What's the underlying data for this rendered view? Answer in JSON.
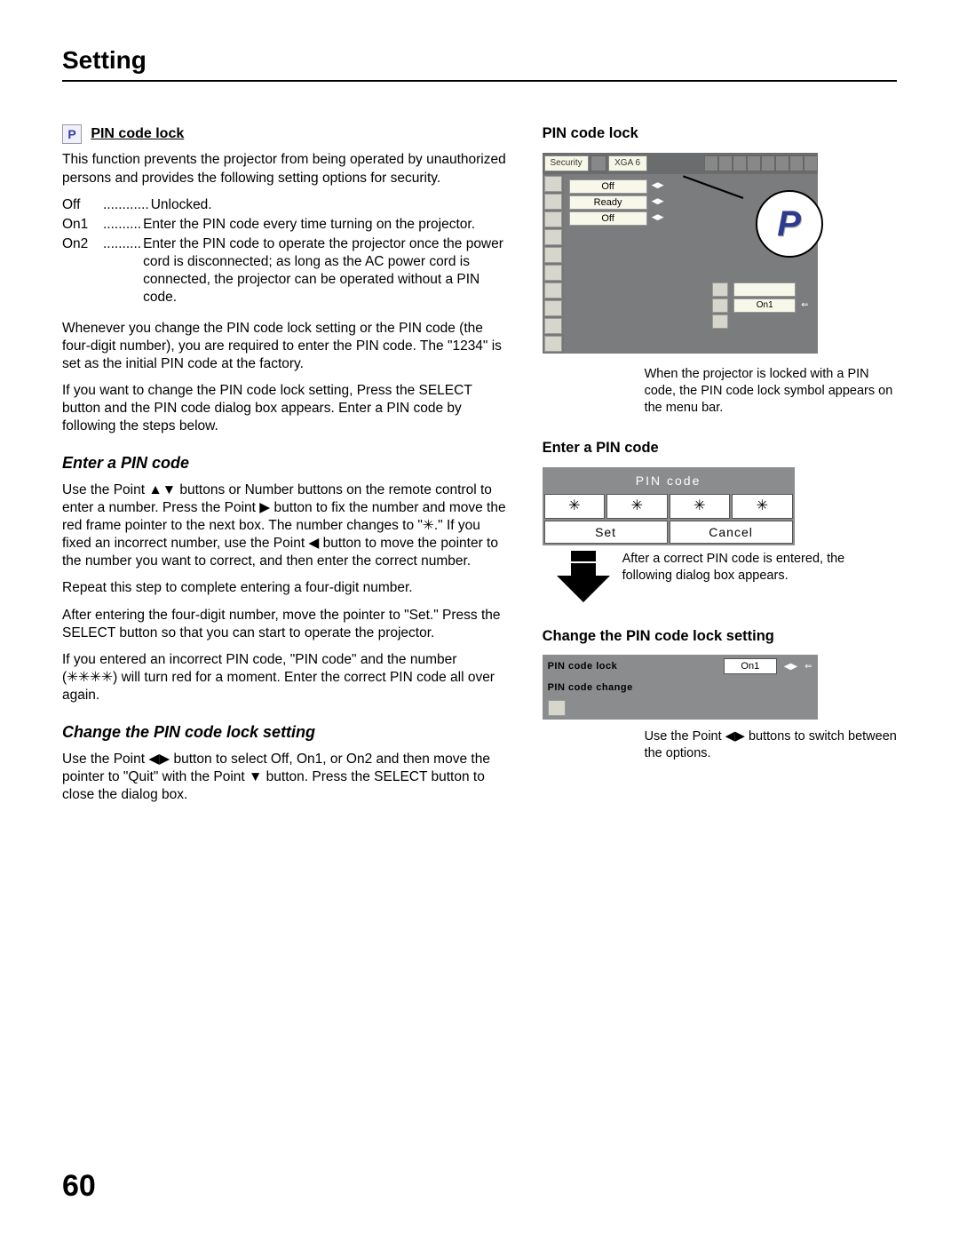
{
  "header": {
    "title": "Setting"
  },
  "left": {
    "pin_lock_heading": "PIN code lock",
    "intro": "This function prevents the projector from being operated by unauthorized persons and provides the following setting options for security.",
    "options": [
      {
        "label": "Off",
        "dots": "............ ",
        "desc": "Unlocked."
      },
      {
        "label": "On1",
        "dots": ".......... ",
        "desc": "Enter the PIN code every time turning on the projector."
      },
      {
        "label": "On2",
        "dots": ".......... ",
        "desc": "Enter the PIN code to operate the projector once the power cord is disconnected; as long as the AC power cord is connected, the projector can be operated without a PIN code."
      }
    ],
    "para2": "Whenever you change the PIN code lock setting or the PIN code (the four-digit number), you are required to enter the PIN code. The \"1234\" is set as the initial PIN code at the factory.",
    "para3": "If you want to change the PIN code lock setting, Press the SELECT button and the PIN code dialog box appears. Enter a PIN code by following the steps below.",
    "enter_pin_heading": "Enter a PIN code",
    "enter_pin_p1": "Use the Point ▲▼ buttons or Number buttons on the remote control to enter a number. Press the Point ▶ button to fix the number and move the red frame pointer to the next box. The number changes to \"✳.\" If you fixed an incorrect number, use the Point ◀ button to move the pointer to the number you want to correct, and then enter the correct number.",
    "enter_pin_p2": "Repeat this step to complete entering a four-digit number.",
    "enter_pin_p3": "After entering the four-digit number, move the pointer to \"Set.\" Press the SELECT button so that you can start to operate the projector.",
    "enter_pin_p4": "If you entered an incorrect PIN code, \"PIN code\" and the number (✳✳✳✳) will turn red for a moment. Enter the correct PIN code all over again.",
    "change_heading": "Change the PIN code lock setting",
    "change_p1": "Use the Point ◀▶ button to select Off, On1, or On2 and then move the pointer to \"Quit\" with the Point ▼ button. Press the SELECT button to close the dialog box."
  },
  "right": {
    "fig1_title": "PIN code lock",
    "menu": {
      "tab1": "Security",
      "tab2": "XGA 6",
      "fields": [
        "Off",
        "Ready",
        "Off"
      ],
      "sub": [
        "",
        "On1"
      ]
    },
    "zoom_symbol": "P",
    "fig1_caption": "When the projector is locked with a PIN code, the PIN code lock symbol appears on the menu bar.",
    "fig2_title": "Enter a PIN code",
    "pin_dialog": {
      "title": "PIN code",
      "digits": [
        "✳",
        "✳",
        "✳",
        "✳"
      ],
      "set": "Set",
      "cancel": "Cancel"
    },
    "fig2_caption": "After a correct PIN code is entered, the following dialog box appears.",
    "fig3_title": "Change the PIN code lock setting",
    "change_dialog": {
      "rows": [
        {
          "label": "PIN code lock",
          "value": "On1"
        },
        {
          "label": "PIN code change",
          "value": ""
        }
      ]
    },
    "fig3_caption": "Use the Point ◀▶ buttons to switch between the options."
  },
  "page_number": "60"
}
